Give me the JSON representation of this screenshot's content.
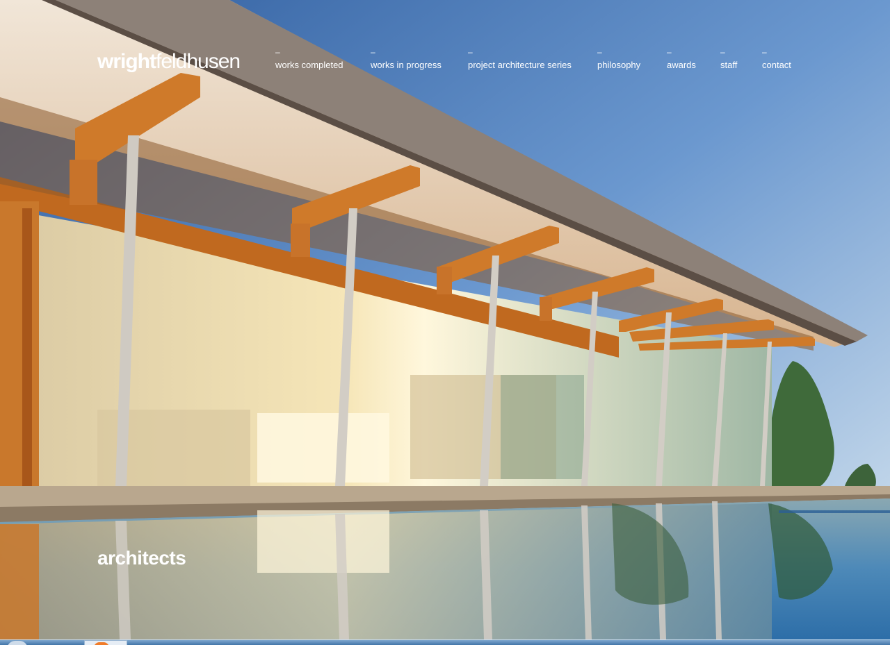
{
  "brand": {
    "logo_bold": "wright",
    "logo_light": "feldhusen"
  },
  "nav": {
    "dash": "–",
    "items": [
      {
        "label": "works completed"
      },
      {
        "label": "works in progress"
      },
      {
        "label": "project architecture series"
      },
      {
        "label": "philosophy"
      },
      {
        "label": "awards"
      },
      {
        "label": "staff"
      },
      {
        "label": "contact"
      }
    ]
  },
  "tagline": "architects",
  "colors": {
    "text": "#ffffff",
    "sky": "#5b8ccc",
    "timber": "#c8742a"
  }
}
